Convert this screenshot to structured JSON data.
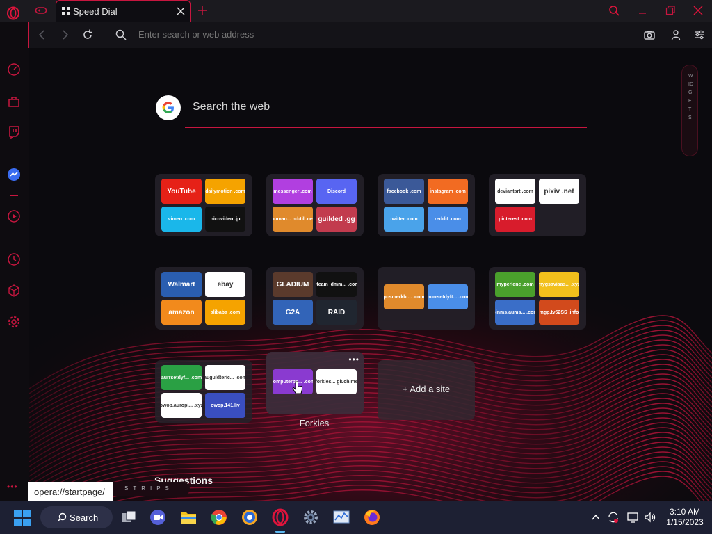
{
  "tab": {
    "title": "Speed Dial"
  },
  "address": {
    "placeholder": "Enter search or web address"
  },
  "search": {
    "placeholder": "Search the web"
  },
  "widgets_label": "WIDGETS",
  "folders": [
    {
      "tiles": [
        {
          "label": "YouTube",
          "bg": "#e62117",
          "big": true
        },
        {
          "label": "dailymotion .com",
          "bg": "#f5a300"
        },
        {
          "label": "vimeo .com",
          "bg": "#1ab7ea"
        },
        {
          "label": "nicovideo .jp",
          "bg": "#111111"
        }
      ]
    },
    {
      "tiles": [
        {
          "label": "messenger .com",
          "bg": "#b13fe0"
        },
        {
          "label": "Discord",
          "bg": "#5865f2"
        },
        {
          "label": "human... nd-til .net",
          "bg": "#e08a2c"
        },
        {
          "label": "guilded .gg",
          "bg": "#c23b4e",
          "big": true
        }
      ]
    },
    {
      "tiles": [
        {
          "label": "facebook .com",
          "bg": "#3b5998"
        },
        {
          "label": "instagram .com",
          "bg": "#f26b22"
        },
        {
          "label": "twitter .com",
          "bg": "#4aa3ea"
        },
        {
          "label": "reddit .com",
          "bg": "#4a8ee8"
        }
      ]
    },
    {
      "tiles": [
        {
          "label": "deviantart .com",
          "bg": "#ffffff",
          "dark": true
        },
        {
          "label": "pixiv .net",
          "bg": "#ffffff",
          "dark": true,
          "big": true
        },
        {
          "label": "pinterest .com",
          "bg": "#d81c2c"
        }
      ]
    },
    {
      "tiles": [
        {
          "label": "Walmart",
          "bg": "#2a5eb0",
          "big": true
        },
        {
          "label": "ebay",
          "bg": "#ffffff",
          "dark": true,
          "big": true
        },
        {
          "label": "amazon",
          "bg": "#f28a1c",
          "big": true
        },
        {
          "label": "alibaba .com",
          "bg": "#f5a300"
        }
      ]
    },
    {
      "tiles": [
        {
          "label": "GLADIUM",
          "bg": "#5a3a2c",
          "big": true
        },
        {
          "label": "steam_dmm... .com",
          "bg": "#111111"
        },
        {
          "label": "G2A",
          "bg": "#3264b8",
          "big": true
        },
        {
          "label": "RAID",
          "bg": "#202630",
          "big": true
        }
      ]
    },
    {
      "tiles": [
        {
          "label": "pcsmerkbl... .com",
          "bg": "#e08a2c"
        },
        {
          "label": "murrsetdyft... .com",
          "bg": "#4a8ee8"
        }
      ]
    },
    {
      "tiles": [
        {
          "label": "myperlene .com",
          "bg": "#4aa02c"
        },
        {
          "label": "mygsaviaas... .xyz",
          "bg": "#f2c01c"
        },
        {
          "label": "pinms.aums... .com",
          "bg": "#3a6ec8"
        },
        {
          "label": "mgp.tv52SS .info",
          "bg": "#d24a1c"
        }
      ]
    },
    {
      "tiles": [
        {
          "label": "aurrsetdyf... .com",
          "bg": "#2aa044"
        },
        {
          "label": "auguldteric... .com",
          "bg": "#ffffff",
          "dark": true
        },
        {
          "label": "owop.auropi... .xyz",
          "bg": "#ffffff",
          "dark": true
        },
        {
          "label": "owop.141.liv",
          "bg": "#3a4ec0"
        }
      ]
    },
    {
      "name": "Forkies",
      "tiles": [
        {
          "label": "computerps... .com",
          "bg": "#8a3ad0"
        },
        {
          "label": "forkies... gl0ch.me",
          "bg": "#ffffff",
          "dark": true
        }
      ]
    }
  ],
  "add_site": "+ Add a site",
  "suggestions_heading": "Suggestions",
  "url_tooltip": "opera://startpage/",
  "strips_label": "STRIPS",
  "taskbar": {
    "search_label": "Search",
    "time": "3:10 AM",
    "date": "1/15/2023"
  },
  "colors": {
    "accent": "#c7163f",
    "taskbar": "#1d2033"
  }
}
